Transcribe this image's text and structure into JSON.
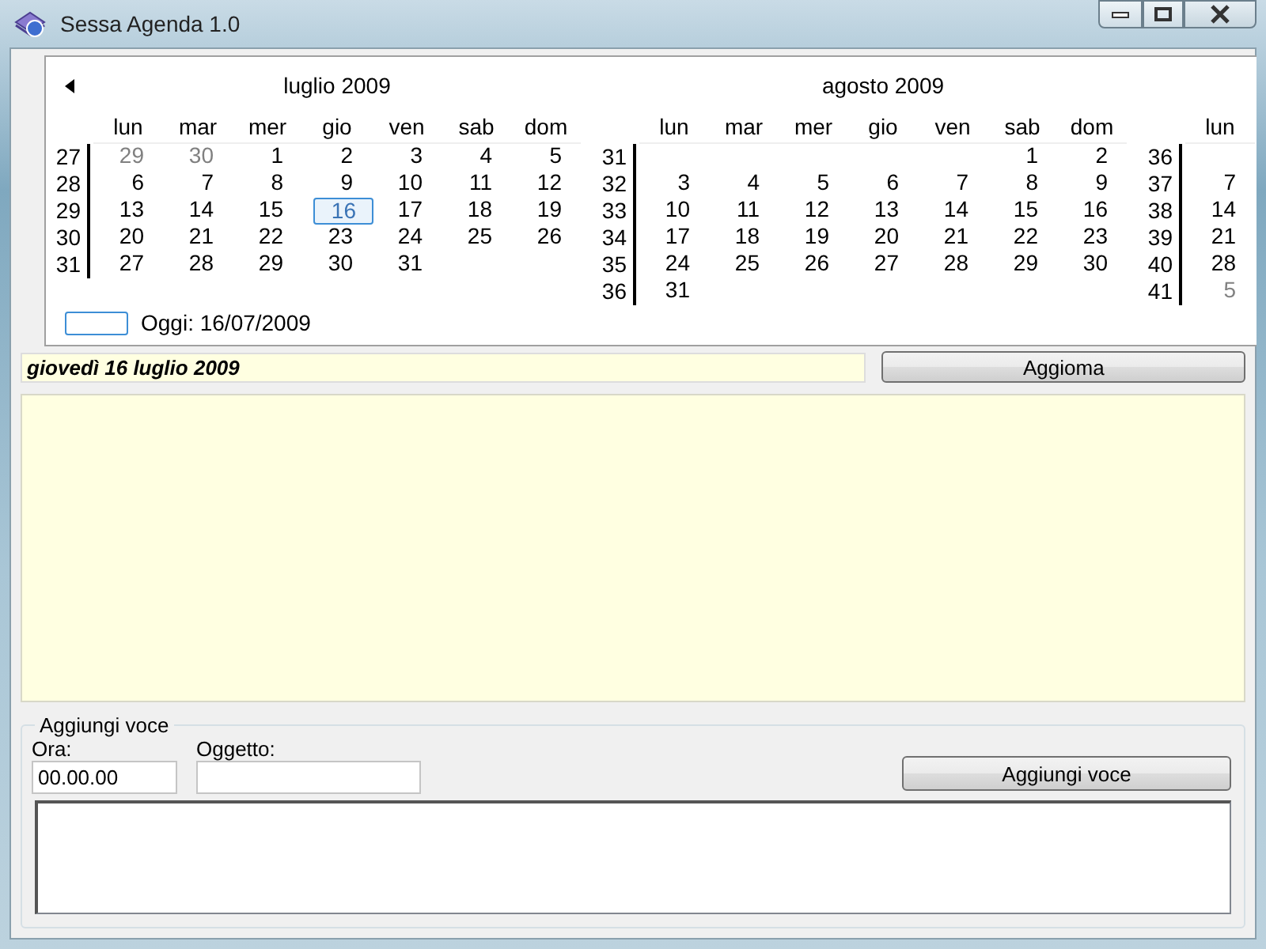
{
  "window": {
    "title": "Sessa Agenda 1.0"
  },
  "calendar": {
    "months": [
      {
        "title": "luglio 2009",
        "weekdays": [
          "lun",
          "mar",
          "mer",
          "gio",
          "ven",
          "sab",
          "dom"
        ],
        "weeks": [
          {
            "number": "27",
            "days": [
              {
                "text": "29",
                "adjacent": true,
                "selected": false
              },
              {
                "text": "30",
                "adjacent": true,
                "selected": false
              },
              {
                "text": "1",
                "adjacent": false,
                "selected": false
              },
              {
                "text": "2",
                "adjacent": false,
                "selected": false
              },
              {
                "text": "3",
                "adjacent": false,
                "selected": false
              },
              {
                "text": "4",
                "adjacent": false,
                "selected": false
              },
              {
                "text": "5",
                "adjacent": false,
                "selected": false
              }
            ]
          },
          {
            "number": "28",
            "days": [
              {
                "text": "6",
                "adjacent": false,
                "selected": false
              },
              {
                "text": "7",
                "adjacent": false,
                "selected": false
              },
              {
                "text": "8",
                "adjacent": false,
                "selected": false
              },
              {
                "text": "9",
                "adjacent": false,
                "selected": false
              },
              {
                "text": "10",
                "adjacent": false,
                "selected": false
              },
              {
                "text": "11",
                "adjacent": false,
                "selected": false
              },
              {
                "text": "12",
                "adjacent": false,
                "selected": false
              }
            ]
          },
          {
            "number": "29",
            "days": [
              {
                "text": "13",
                "adjacent": false,
                "selected": false
              },
              {
                "text": "14",
                "adjacent": false,
                "selected": false
              },
              {
                "text": "15",
                "adjacent": false,
                "selected": false
              },
              {
                "text": "16",
                "adjacent": false,
                "selected": true
              },
              {
                "text": "17",
                "adjacent": false,
                "selected": false
              },
              {
                "text": "18",
                "adjacent": false,
                "selected": false
              },
              {
                "text": "19",
                "adjacent": false,
                "selected": false
              }
            ]
          },
          {
            "number": "30",
            "days": [
              {
                "text": "20",
                "adjacent": false,
                "selected": false
              },
              {
                "text": "21",
                "adjacent": false,
                "selected": false
              },
              {
                "text": "22",
                "adjacent": false,
                "selected": false
              },
              {
                "text": "23",
                "adjacent": false,
                "selected": false
              },
              {
                "text": "24",
                "adjacent": false,
                "selected": false
              },
              {
                "text": "25",
                "adjacent": false,
                "selected": false
              },
              {
                "text": "26",
                "adjacent": false,
                "selected": false
              }
            ]
          },
          {
            "number": "31",
            "align_end": false,
            "days": [
              {
                "text": "27",
                "adjacent": false,
                "selected": false
              },
              {
                "text": "28",
                "adjacent": false,
                "selected": false
              },
              {
                "text": "29",
                "adjacent": false,
                "selected": false
              },
              {
                "text": "30",
                "adjacent": false,
                "selected": false
              },
              {
                "text": "31",
                "adjacent": false,
                "selected": false
              }
            ]
          }
        ]
      },
      {
        "title": "agosto 2009",
        "weekdays": [
          "lun",
          "mar",
          "mer",
          "gio",
          "ven",
          "sab",
          "dom"
        ],
        "weeks": [
          {
            "number": "31",
            "align_end": true,
            "days": [
              {
                "text": "1",
                "adjacent": false,
                "selected": false
              },
              {
                "text": "2",
                "adjacent": false,
                "selected": false
              }
            ]
          },
          {
            "number": "32",
            "days": [
              {
                "text": "3",
                "adjacent": false,
                "selected": false
              },
              {
                "text": "4",
                "adjacent": false,
                "selected": false
              },
              {
                "text": "5",
                "adjacent": false,
                "selected": false
              },
              {
                "text": "6",
                "adjacent": false,
                "selected": false
              },
              {
                "text": "7",
                "adjacent": false,
                "selected": false
              },
              {
                "text": "8",
                "adjacent": false,
                "selected": false
              },
              {
                "text": "9",
                "adjacent": false,
                "selected": false
              }
            ]
          },
          {
            "number": "33",
            "days": [
              {
                "text": "10",
                "adjacent": false,
                "selected": false
              },
              {
                "text": "11",
                "adjacent": false,
                "selected": false
              },
              {
                "text": "12",
                "adjacent": false,
                "selected": false
              },
              {
                "text": "13",
                "adjacent": false,
                "selected": false
              },
              {
                "text": "14",
                "adjacent": false,
                "selected": false
              },
              {
                "text": "15",
                "adjacent": false,
                "selected": false
              },
              {
                "text": "16",
                "adjacent": false,
                "selected": false
              }
            ]
          },
          {
            "number": "34",
            "days": [
              {
                "text": "17",
                "adjacent": false,
                "selected": false
              },
              {
                "text": "18",
                "adjacent": false,
                "selected": false
              },
              {
                "text": "19",
                "adjacent": false,
                "selected": false
              },
              {
                "text": "20",
                "adjacent": false,
                "selected": false
              },
              {
                "text": "21",
                "adjacent": false,
                "selected": false
              },
              {
                "text": "22",
                "adjacent": false,
                "selected": false
              },
              {
                "text": "23",
                "adjacent": false,
                "selected": false
              }
            ]
          },
          {
            "number": "35",
            "days": [
              {
                "text": "24",
                "adjacent": false,
                "selected": false
              },
              {
                "text": "25",
                "adjacent": false,
                "selected": false
              },
              {
                "text": "26",
                "adjacent": false,
                "selected": false
              },
              {
                "text": "27",
                "adjacent": false,
                "selected": false
              },
              {
                "text": "28",
                "adjacent": false,
                "selected": false
              },
              {
                "text": "29",
                "adjacent": false,
                "selected": false
              },
              {
                "text": "30",
                "adjacent": false,
                "selected": false
              }
            ]
          },
          {
            "number": "36",
            "align_end": false,
            "days": [
              {
                "text": "31",
                "adjacent": false,
                "selected": false
              }
            ]
          }
        ]
      },
      {
        "weekdays": [
          "lun"
        ],
        "weeks": [
          {
            "number": "36"
          },
          {
            "number": "37",
            "days": [
              {
                "text": "7",
                "adjacent": false,
                "selected": false
              }
            ]
          },
          {
            "number": "38",
            "days": [
              {
                "text": "14",
                "adjacent": false,
                "selected": false
              }
            ]
          },
          {
            "number": "39",
            "days": [
              {
                "text": "21",
                "adjacent": false,
                "selected": false
              }
            ]
          },
          {
            "number": "40",
            "days": [
              {
                "text": "28",
                "adjacent": false,
                "selected": false
              }
            ]
          },
          {
            "number": "41",
            "days": [
              {
                "text": "5",
                "adjacent": true,
                "selected": false
              }
            ]
          }
        ]
      }
    ],
    "today": "Oggi: 16/07/2009"
  },
  "date_bar": {
    "text": "giovedì 16 luglio 2009",
    "button": "Aggioma"
  },
  "add_entry": {
    "title": "Aggiungi voce",
    "time_label": "Ora:",
    "time_value": "00.00.00",
    "subject_label": "Oggetto:",
    "button": "Aggiungi voce"
  }
}
